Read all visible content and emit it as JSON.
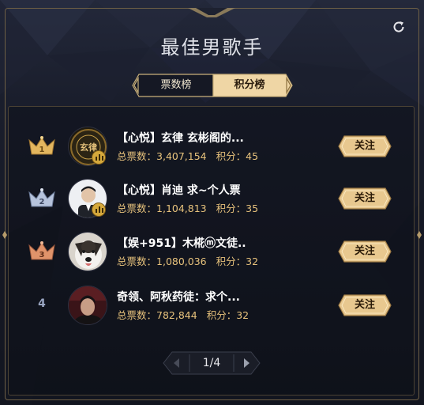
{
  "title": "最佳男歌手",
  "tabs": [
    {
      "label": "票数榜",
      "active": false
    },
    {
      "label": "积分榜",
      "active": true
    }
  ],
  "stats_labels": {
    "votes": "总票数：",
    "points": "积分："
  },
  "rows": [
    {
      "rank": "1",
      "name": "【心悦】玄律 玄彬阁的...",
      "votes": "3,407,154",
      "points": "45",
      "follow_label": "关注",
      "badge": "gold-crown"
    },
    {
      "rank": "2",
      "name": "【心悦】肖迪 求~个人票",
      "votes": "1,104,813",
      "points": "35",
      "follow_label": "关注",
      "badge": "silver-crown"
    },
    {
      "rank": "3",
      "name": "【娱+951】木椛ⓜ文徒..",
      "votes": "1,080,036",
      "points": "32",
      "follow_label": "关注",
      "badge": "bronze-crown"
    },
    {
      "rank": "4",
      "name": "奇领、阿秋药徒：求个...",
      "votes": "782,844",
      "points": "32",
      "follow_label": "关注",
      "badge": "none"
    }
  ],
  "pager": {
    "text": "1/4"
  },
  "colors": {
    "gold": "#e7c27c",
    "button_gold": "#e8c88f",
    "background": "#12151f",
    "frame": "#6e5f45"
  }
}
